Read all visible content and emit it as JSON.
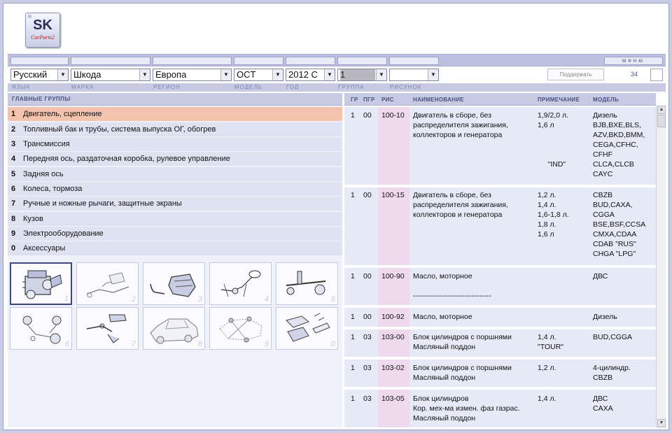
{
  "logo": {
    "main": "SK",
    "sub": "CarParts2",
    "corner": "R"
  },
  "toolbar": {
    "menu_label": "меню",
    "support_button": "Поддержать",
    "count": "34"
  },
  "selectors": {
    "language": "Русский",
    "brand": "Шкода",
    "region": "Европа",
    "model": "OCT",
    "year": "2012  C",
    "group": "1",
    "image": ""
  },
  "selector_labels": {
    "language": "ЯЗЫК",
    "brand": "МАРКА",
    "region": "РЕГИОН",
    "model": "МОДЕЛЬ",
    "year": "ГОД",
    "group": "ГРУППА",
    "image": "РИСУНОК"
  },
  "left_panel": {
    "header": "ГЛАВНЫЕ ГРУППЫ",
    "groups": [
      {
        "num": "1",
        "label": "Двигатель, сцепление",
        "active": true
      },
      {
        "num": "2",
        "label": "Топливный бак и трубы, система выпуска ОГ, обогрев"
      },
      {
        "num": "3",
        "label": "Трансмиссия"
      },
      {
        "num": "4",
        "label": "Передняя ось, раздаточная коробка, рулевое управление"
      },
      {
        "num": "5",
        "label": "Задняя ось"
      },
      {
        "num": "6",
        "label": "Колеса, тормоза"
      },
      {
        "num": "7",
        "label": "Ручные и ножные рычаги, защитные экраны"
      },
      {
        "num": "8",
        "label": "Кузов"
      },
      {
        "num": "9",
        "label": "Электрооборудование"
      },
      {
        "num": "0",
        "label": "Аксессуары"
      }
    ],
    "thumbnails": [
      {
        "num": "1",
        "icon": "engine-icon",
        "active": true
      },
      {
        "num": "2",
        "icon": "fuel-system-icon"
      },
      {
        "num": "3",
        "icon": "transmission-icon"
      },
      {
        "num": "4",
        "icon": "steering-icon"
      },
      {
        "num": "5",
        "icon": "rear-axle-icon"
      },
      {
        "num": "6",
        "icon": "brakes-icon"
      },
      {
        "num": "7",
        "icon": "pedals-icon"
      },
      {
        "num": "8",
        "icon": "car-body-icon"
      },
      {
        "num": "9",
        "icon": "wiring-icon"
      },
      {
        "num": "0",
        "icon": "accessories-icon"
      }
    ]
  },
  "parts_table": {
    "headers": {
      "gr": "ГР",
      "pgr": "ПГР",
      "ris": "РИС",
      "name": "НАИМЕНОВАНИЕ",
      "note": "ПРИМЕЧАНИЕ",
      "model": "МОДЕЛЬ"
    },
    "rows": [
      {
        "gr": "1",
        "pgr": "00",
        "ris": "100-10",
        "name": "Двигатель в сборе, без\nраспределителя зажигания,\nколлекторов и генератора",
        "note": "1,9/2,0 л.\n1,6 л\n\n\n\n     \"IND\"",
        "model": "Дизель\nBJB,BXE,BLS,\nAZV,BKD,BMM,\nCEGA,CFHC,\nCFHF\nCLCA,CLCB\nCAYC"
      },
      {
        "gr": "1",
        "pgr": "00",
        "ris": "100-15",
        "name": "Двигатель в сборе, без\nраспределителя зажигания,\nколлекторов и генератора",
        "note": "1,2 л.\n1,4 л.\n1,6-1,8 л.\n1,8 л.\n1,6 л",
        "model": "CBZB\nBUD,CAXA,\nCGGA\nBSE,BSF,CCSA\nCMXA,CDAA\nCDAB \"RUS\"\nCHGA \"LPG\""
      },
      {
        "gr": "1",
        "pgr": "00",
        "ris": "100-90",
        "name": "Масло, моторное\n\n--------------------------------",
        "note": "",
        "model": "ДВС"
      },
      {
        "gr": "1",
        "pgr": "00",
        "ris": "100-92",
        "name": "Масло, моторное",
        "note": "",
        "model": "Дизель"
      },
      {
        "gr": "1",
        "pgr": "03",
        "ris": "103-00",
        "name": "Блок цилиндров с поршнями\nМасляный поддон",
        "note": "1,4 л.\n\"TOUR\"",
        "model": "BUD,CGGA"
      },
      {
        "gr": "1",
        "pgr": "03",
        "ris": "103-02",
        "name": "Блок цилиндров с поршнями\nМасляный поддон",
        "note": "1,2 л.",
        "model": "4-цилиндр.\nCBZB"
      },
      {
        "gr": "1",
        "pgr": "03",
        "ris": "103-05",
        "name": "Блок цилиндров\nКор. мех-ма измен. фаз газрас.\nМасляный поддон",
        "note": "1,4 л.",
        "model": "ДВС\nCAXA"
      }
    ]
  }
}
